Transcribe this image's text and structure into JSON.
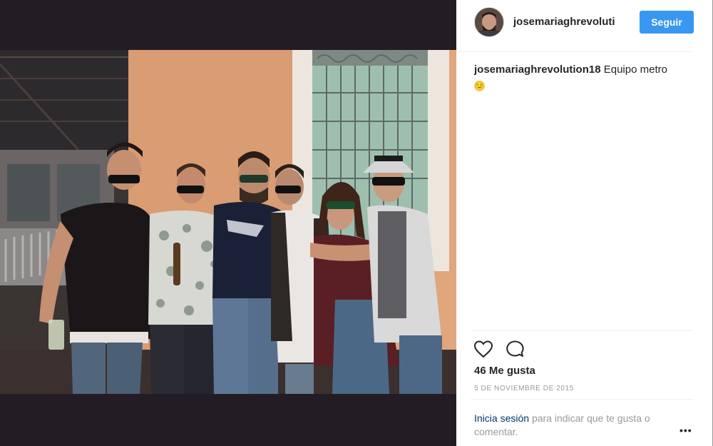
{
  "post": {
    "username": "josemariaghrevoluti",
    "follow_label": "Seguir",
    "caption_user": "josemariaghrevolution18",
    "caption_text": "Equipo metro",
    "caption_emoji": "😏",
    "likes_label": "46 Me gusta",
    "date_label": "5 de noviembre de 2015"
  },
  "footer": {
    "login_label": "Inicia sesión",
    "login_suffix": "para indicar que te gusta o comentar.",
    "more_label": "•••"
  },
  "icons": {
    "like": "heart-icon",
    "comment": "comment-icon",
    "more": "more-options-icon"
  },
  "colors": {
    "accent": "#3897f0",
    "background_dark": "#231c24",
    "wall": "#e1a67c",
    "link": "#003569"
  }
}
